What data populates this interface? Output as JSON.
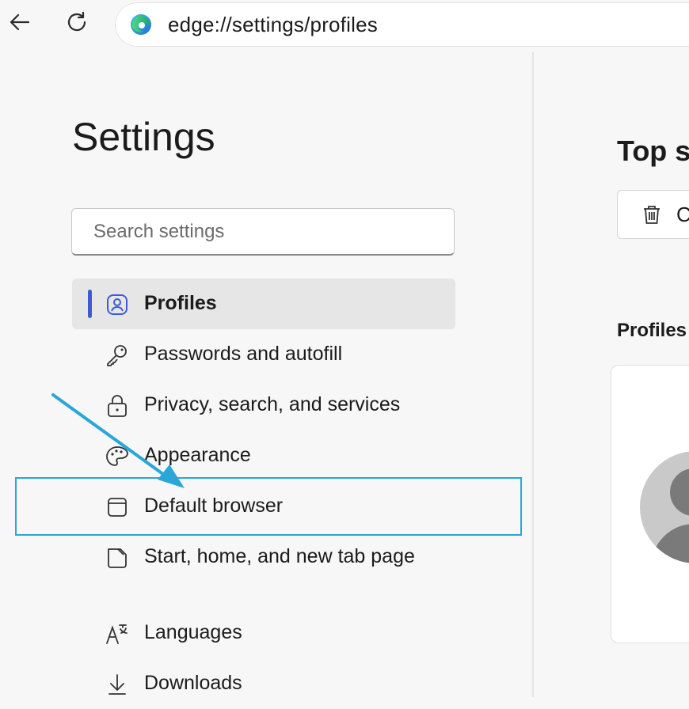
{
  "browser": {
    "url": "edge://settings/profiles",
    "icons": {
      "back": "back-arrow-icon",
      "refresh": "refresh-icon",
      "logo": "edge-logo-icon"
    }
  },
  "sidebar": {
    "title": "Settings",
    "search_placeholder": "Search settings",
    "items": [
      {
        "label": "Profiles",
        "icon": "profile-icon",
        "active": true
      },
      {
        "label": "Passwords and autofill",
        "icon": "key-icon",
        "active": false
      },
      {
        "label": "Privacy, search, and services",
        "icon": "lock-icon",
        "active": false
      },
      {
        "label": "Appearance",
        "icon": "palette-icon",
        "active": false
      },
      {
        "label": "Default browser",
        "icon": "browser-window-icon",
        "active": false,
        "highlighted": true
      },
      {
        "label": "Start, home, and new tab page",
        "icon": "home-page-icon",
        "active": false
      },
      {
        "label": "Languages",
        "icon": "languages-icon",
        "active": false
      },
      {
        "label": "Downloads",
        "icon": "download-icon",
        "active": false
      }
    ]
  },
  "content": {
    "section_heading": "Top s",
    "clear_button_label": "C",
    "profiles_heading": "Profiles"
  },
  "colors": {
    "accent": "#3d5bd8",
    "highlight": "#2aa6d8",
    "background": "#f7f7f7"
  }
}
